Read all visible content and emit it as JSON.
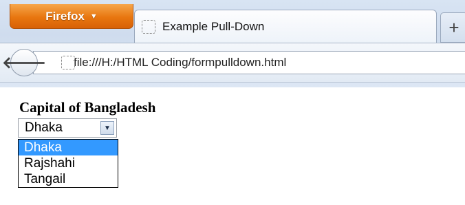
{
  "browser": {
    "menu_button_label": "Firefox",
    "tab_title": "Example Pull-Down",
    "new_tab_symbol": "+",
    "back_symbol": "🡐",
    "url": "file:///H:/HTML Coding/formpulldown.html"
  },
  "form": {
    "label": "Capital of Bangladesh",
    "select_value": "Dhaka",
    "options": [
      "Dhaka",
      "Rajshahi",
      "Tangail"
    ],
    "selected_option_index": 0
  },
  "colors": {
    "firefox_button": "#e8760f",
    "option_highlight": "#3399ff"
  },
  "icons": {
    "menu_caret": "caret-down-icon",
    "tab_page": "page-icon",
    "url_page": "page-icon",
    "back": "back-arrow-icon",
    "select": "chevron-down-icon"
  }
}
